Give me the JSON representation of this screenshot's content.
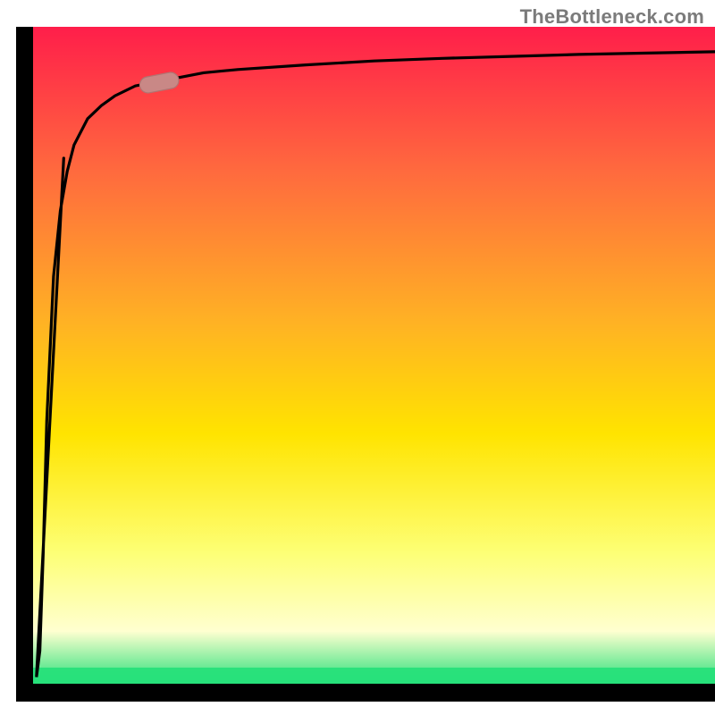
{
  "watermark": "TheBottleneck.com",
  "colors": {
    "gradient_top": "#ff1e4a",
    "gradient_mid1": "#ff6a3e",
    "gradient_mid2": "#ffb224",
    "gradient_mid3": "#ffe400",
    "gradient_mid4": "#fdff75",
    "gradient_bottom": "#ffffd0",
    "gradient_green": "#27e07a",
    "axis": "#000000",
    "curve": "#000000",
    "marker_fill": "#c98886",
    "marker_stroke": "#b07472"
  },
  "chart_data": {
    "type": "line",
    "title": "",
    "xlabel": "",
    "ylabel": "",
    "xlim": [
      0,
      100
    ],
    "ylim": [
      0,
      100
    ],
    "series": [
      {
        "name": "bottleneck-curve",
        "x": [
          0.5,
          1,
          1.5,
          2,
          3,
          4,
          5,
          6,
          8,
          10,
          12,
          15,
          20,
          25,
          30,
          40,
          50,
          60,
          70,
          80,
          90,
          100
        ],
        "y": [
          1,
          5,
          20,
          40,
          62,
          72,
          78,
          82,
          86,
          88,
          89.5,
          91,
          92,
          93,
          93.5,
          94.2,
          94.8,
          95.2,
          95.5,
          95.8,
          96,
          96.2
        ]
      }
    ],
    "marker": {
      "x": 18.5,
      "y": 91.5
    },
    "green_band_y": [
      0,
      4
    ]
  }
}
